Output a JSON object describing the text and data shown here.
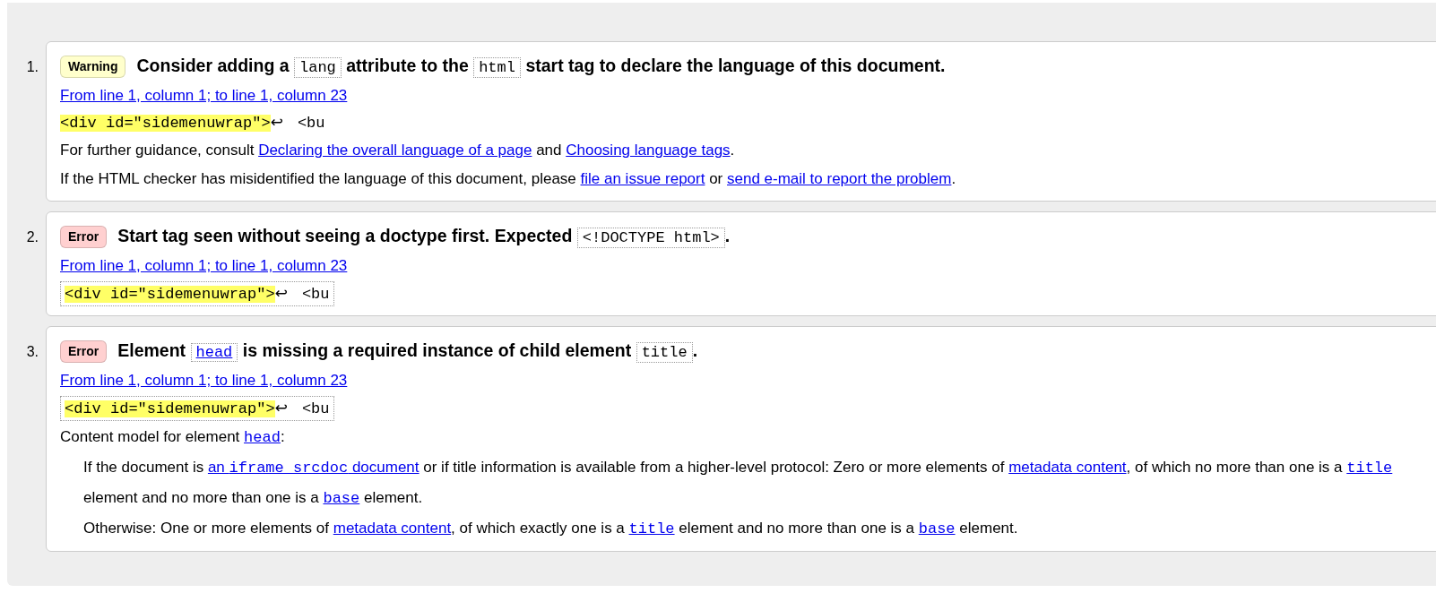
{
  "messages": [
    {
      "number": "1.",
      "badge": {
        "text": "Warning",
        "color": "#ffffcc"
      },
      "title": [
        {
          "kind": "text",
          "text": "Consider adding a "
        },
        {
          "kind": "code",
          "text": "lang"
        },
        {
          "kind": "text",
          "text": " attribute to the "
        },
        {
          "kind": "code",
          "text": "html"
        },
        {
          "kind": "text",
          "text": " start tag to declare the language of this document."
        }
      ],
      "location": "From line 1, column 1; to line 1, column 23",
      "extract": {
        "boxed": false,
        "highlight": "<div id=\"sidemenuwrap\">",
        "linebreak": "↩",
        "rest": "<bu"
      },
      "paragraphs": [
        {
          "kind": "plain",
          "segments": [
            {
              "kind": "text",
              "text": "For further guidance, consult "
            },
            {
              "kind": "link",
              "text": "Declaring the overall language of a page"
            },
            {
              "kind": "text",
              "text": " and "
            },
            {
              "kind": "link",
              "text": "Choosing language tags"
            },
            {
              "kind": "text",
              "text": "."
            }
          ]
        },
        {
          "kind": "plain",
          "segments": [
            {
              "kind": "text",
              "text": "If the HTML checker has misidentified the language of this document, please "
            },
            {
              "kind": "link",
              "text": "file an issue report"
            },
            {
              "kind": "text",
              "text": " or "
            },
            {
              "kind": "link",
              "text": "send e-mail to report the problem"
            },
            {
              "kind": "text",
              "text": "."
            }
          ]
        }
      ]
    },
    {
      "number": "2.",
      "badge": {
        "text": "Error",
        "color": "#ffd0d0"
      },
      "title": [
        {
          "kind": "text",
          "text": "Start tag seen without seeing a doctype first. Expected "
        },
        {
          "kind": "code",
          "text": "<!DOCTYPE html>"
        },
        {
          "kind": "text",
          "text": "."
        }
      ],
      "location": "From line 1, column 1; to line 1, column 23",
      "extract": {
        "boxed": true,
        "highlight": "<div id=\"sidemenuwrap\">",
        "linebreak": "↩",
        "rest": "<bu"
      }
    },
    {
      "number": "3.",
      "badge": {
        "text": "Error",
        "color": "#ffd0d0"
      },
      "title": [
        {
          "kind": "text",
          "text": "Element "
        },
        {
          "kind": "code_link",
          "text": "head"
        },
        {
          "kind": "text",
          "text": " is missing a required instance of child element "
        },
        {
          "kind": "code",
          "text": "title"
        },
        {
          "kind": "text",
          "text": "."
        }
      ],
      "location": "From line 1, column 1; to line 1, column 23",
      "extract": {
        "boxed": true,
        "highlight": "<div id=\"sidemenuwrap\">",
        "linebreak": "↩",
        "rest": "<bu"
      },
      "paragraphs": [
        {
          "kind": "plain",
          "segments": [
            {
              "kind": "text",
              "text": "Content model for element "
            },
            {
              "kind": "code_link",
              "text": "head"
            },
            {
              "kind": "text",
              "text": ":"
            }
          ]
        },
        {
          "kind": "indented",
          "segments": [
            {
              "kind": "text",
              "text": "If the document is "
            },
            {
              "kind": "mixed_link",
              "parts": [
                "an ",
                "iframe srcdoc",
                " document"
              ]
            },
            {
              "kind": "text",
              "text": " or if title information is available from a higher-level protocol: Zero or more elements of "
            },
            {
              "kind": "link",
              "text": "metadata content"
            },
            {
              "kind": "text",
              "text": ", of which no more than one is a "
            },
            {
              "kind": "code_link",
              "text": "title"
            },
            {
              "kind": "text",
              "text": " element and no more than one is a "
            },
            {
              "kind": "code_link",
              "text": "base"
            },
            {
              "kind": "text",
              "text": " element."
            }
          ]
        },
        {
          "kind": "indented",
          "segments": [
            {
              "kind": "text",
              "text": "Otherwise: One or more elements of "
            },
            {
              "kind": "link",
              "text": "metadata content"
            },
            {
              "kind": "text",
              "text": ", of which exactly one is a "
            },
            {
              "kind": "code_link",
              "text": "title"
            },
            {
              "kind": "text",
              "text": " element and no more than one is a "
            },
            {
              "kind": "code_link",
              "text": "base"
            },
            {
              "kind": "text",
              "text": " element."
            }
          ]
        }
      ]
    }
  ]
}
